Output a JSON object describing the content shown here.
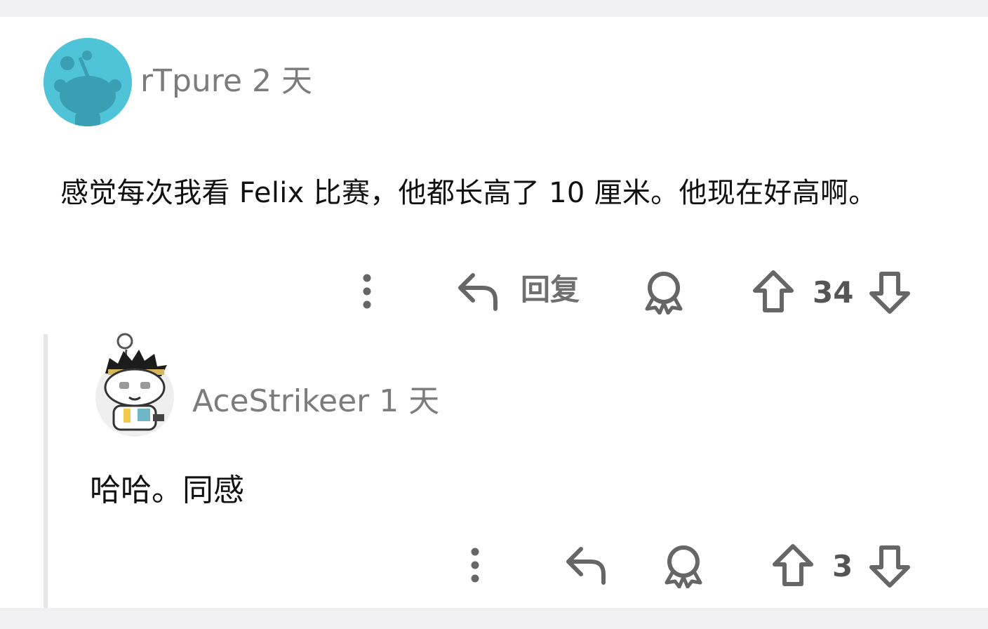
{
  "comments": [
    {
      "username": "rTpure",
      "age": "2 天",
      "body": "感觉每次我看 Felix 比赛，他都长高了 10 厘米。他现在好高啊。",
      "reply_label": "回复",
      "votes": "34",
      "avatar_color": "#4fc3d7"
    },
    {
      "username": "AceStrikeer",
      "age": "1 天",
      "body": "哈哈。同感",
      "votes": "3"
    }
  ],
  "icons": {
    "more": "more-vertical-icon",
    "reply": "reply-icon",
    "award": "award-icon",
    "upvote": "upvote-icon",
    "downvote": "downvote-icon"
  }
}
